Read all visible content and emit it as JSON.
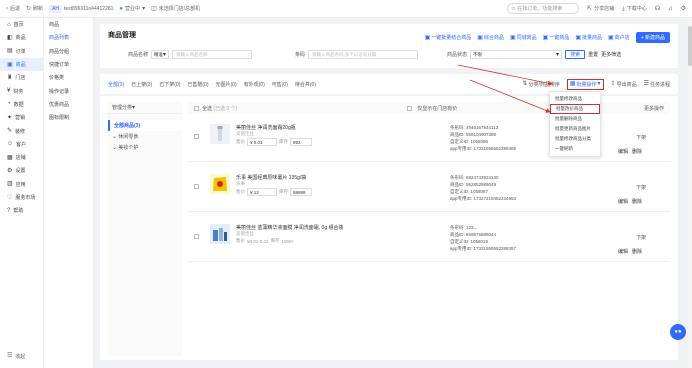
{
  "topbar": {
    "back": "后退",
    "refresh": "刷新",
    "store_badge": "AH",
    "store_name": "test896311o44412281",
    "status": "营业中",
    "channel": "未选择门店/总部机",
    "search_placeholder": "在找订单、功能搜索",
    "download": "下载中心",
    "share": "分享店铺"
  },
  "sidebar1": {
    "items": [
      "首页",
      "商品",
      "订单",
      "商品",
      "门店",
      "财务",
      "数据",
      "营销",
      "装修",
      "客户",
      "店铺",
      "设置",
      "应用",
      "服务市场",
      "帮助"
    ],
    "footer": "收起"
  },
  "sidebar2": {
    "items": [
      "商品",
      "商品列表",
      "商品分组",
      "快捷订单",
      "价格类",
      "操作记录",
      "优惠商品",
      "图标限制"
    ]
  },
  "header": {
    "title": "商品管理",
    "actions": [
      "一键批量结合商品",
      "综合商品",
      "同城商品",
      "一键商品",
      "批量商品",
      "商户店"
    ],
    "primary_button": "+ 新建商品",
    "filters": {
      "name_label": "商品名称",
      "name_select": "精准",
      "name_placeholder": "请输入商品名称",
      "code_label": "条码",
      "code_placeholder": "请输入商品条码,多个以逗号分隔",
      "status_label": "商品状态",
      "status_value": "不限",
      "search_button": "搜索",
      "reset": "重置",
      "more": "更多筛选"
    }
  },
  "tabs": {
    "items": [
      "全部(3)",
      "已上架(3)",
      "已下架(0)",
      "已售罄(0)",
      "无图片(0)",
      "有外观(0)",
      "可售(0)",
      "待合并(0)"
    ],
    "right_actions": [
      "分类/商品排序",
      "批量操作",
      "导出商品",
      "任务进程"
    ]
  },
  "categories": {
    "header": "管理分类",
    "items": [
      "全部商品(3)",
      "休闲零食",
      "美妆个护"
    ]
  },
  "table": {
    "select_all": "全选",
    "selected": "(已选 0 个)",
    "col_ids": "仅显示在门店有价",
    "col_ops": "更多操作"
  },
  "rows": [
    {
      "title": "美丽佳丝 净润洗面霜20g瓶",
      "sub": "美丽佳丝",
      "price_label": "售价",
      "price": "¥ 0.01",
      "stock_label": "库存",
      "stock": "992",
      "barcode": "条形码: 4946167544113",
      "goods_id": "商品ID: 559104907389",
      "custom_id": "自定义ID: 1058086",
      "app_id": "app专用ID: 17331955552289389",
      "status": "下架",
      "actions": [
        "编辑",
        "删除"
      ]
    },
    {
      "title": "乐事 美国经典原味薯片 135g/袋",
      "sub": "乐事",
      "price_label": "售价",
      "price": "¥ 12",
      "stock_label": "库存",
      "stock": "99999",
      "barcode": "条形码: 6924743924130",
      "goods_id": "商品ID: 552852989049",
      "custom_id": "自定义ID: 1058087",
      "app_id": "app专用ID: 17327219452234953",
      "status": "下架",
      "actions": [
        "编辑",
        "删除"
      ]
    },
    {
      "title": "美丽佳丝 蓝藻精华液面膜 净润洗面霜, 0g 组合装",
      "sub": "美丽佳丝",
      "price_label": "售价",
      "price": "¥0.01-0.02",
      "stock_label": "库存",
      "stock": "1000+",
      "barcode": "条形码: 123...",
      "goods_id": "商品ID: 659575889044",
      "custom_id": "自定义ID: 1058019",
      "app_id": "app专用ID: 17331955552289397",
      "status": "下架",
      "actions": [
        "编辑",
        "删除"
      ]
    }
  ],
  "dropdown": {
    "items": [
      "批量修改商品",
      "批量改价商品",
      "批量删除商品",
      "批量更新商品图片",
      "批量修改商品分类",
      "一键刷新"
    ],
    "highlight_index": 1
  },
  "chat_icon": "chat-bubble-icon"
}
